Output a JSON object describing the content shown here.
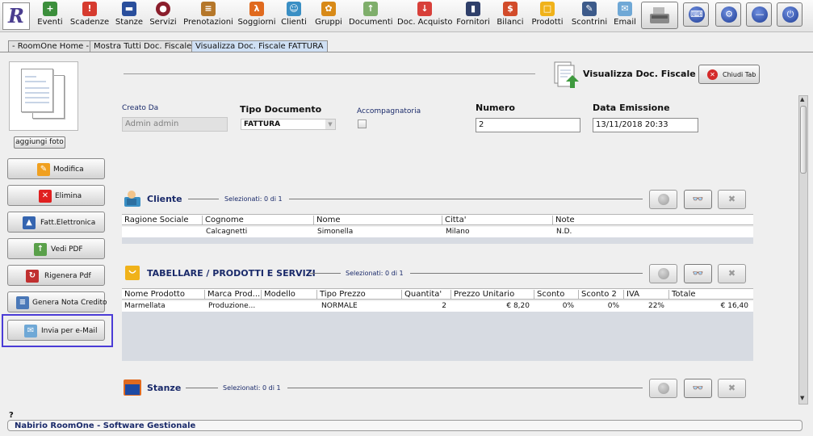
{
  "toolbar": {
    "logo_letter": "R",
    "items": [
      {
        "label": "Eventi",
        "icon": "eventi-icon"
      },
      {
        "label": "Scadenze",
        "icon": "scadenze-icon"
      },
      {
        "label": "Stanze",
        "icon": "stanze-icon"
      },
      {
        "label": "Servizi",
        "icon": "servizi-icon"
      },
      {
        "label": "Prenotazioni",
        "icon": "prenotazioni-icon"
      },
      {
        "label": "Soggiorni",
        "icon": "soggiorni-icon"
      },
      {
        "label": "Clienti",
        "icon": "clienti-icon"
      },
      {
        "label": "Gruppi",
        "icon": "gruppi-icon"
      },
      {
        "label": "Documenti",
        "icon": "documenti-icon"
      },
      {
        "label": "Doc. Acquisto",
        "icon": "doc-acquisto-icon"
      },
      {
        "label": "Fornitori",
        "icon": "fornitori-icon"
      },
      {
        "label": "Bilanci",
        "icon": "bilanci-icon"
      },
      {
        "label": "Prodotti",
        "icon": "prodotti-icon"
      },
      {
        "label": "Scontrini",
        "icon": "scontrini-icon"
      },
      {
        "label": "Email",
        "icon": "email-icon"
      }
    ]
  },
  "tabs": [
    {
      "label": "- RoomOne Home -"
    },
    {
      "label": "Mostra Tutti Doc. Fiscale"
    },
    {
      "label": "Visualizza Doc. Fiscale FATTURA"
    }
  ],
  "left": {
    "add_photo": "aggiungi foto",
    "buttons": [
      {
        "label": "Modifica"
      },
      {
        "label": "Elimina"
      },
      {
        "label": "Fatt.Elettronica"
      },
      {
        "label": "Vedi PDF"
      },
      {
        "label": "Rigenera Pdf"
      },
      {
        "label": "Genera Nota Credito"
      },
      {
        "label": "Invia per e-Mail"
      }
    ]
  },
  "header": {
    "title": "Visualizza Doc. Fiscale",
    "close_label": "Chiudi Tab"
  },
  "form": {
    "creato_da_label": "Creato Da",
    "creato_da_value": "Admin admin",
    "tipo_label": "Tipo Documento",
    "tipo_value": "FATTURA",
    "accompagnatoria_label": "Accompagnatoria",
    "numero_label": "Numero",
    "numero_value": "2",
    "data_label": "Data Emissione",
    "data_value": "13/11/2018 20:33"
  },
  "cliente": {
    "title": "Cliente",
    "selezionati": "Selezionati:  0 di 1",
    "columns": [
      "Ragione Sociale",
      "Cognome",
      "Nome",
      "Citta'",
      "Note"
    ],
    "rows": [
      [
        "",
        "Calcagnetti",
        "Simonella",
        "Milano",
        "N.D."
      ]
    ]
  },
  "prodotti": {
    "title": "TABELLARE / PRODOTTI E SERVIZI",
    "selezionati": "Selezionati:  0 di 1",
    "columns": [
      "Nome Prodotto",
      "Marca Prod...",
      "Modello",
      "Tipo Prezzo",
      "Quantita'",
      "Prezzo Unitario",
      "Sconto",
      "Sconto 2",
      "IVA",
      "Totale"
    ],
    "rows": [
      [
        "Marmellata",
        "Produzione...",
        "",
        "NORMALE",
        "2",
        "€ 8,20",
        "0%",
        "0%",
        "22%",
        "€ 16,40"
      ]
    ]
  },
  "stanze": {
    "title": "Stanze",
    "selezionati": "Selezionati:  0 di 1"
  },
  "status": {
    "question": "?",
    "text": "Nabirio RoomOne - Software Gestionale"
  }
}
